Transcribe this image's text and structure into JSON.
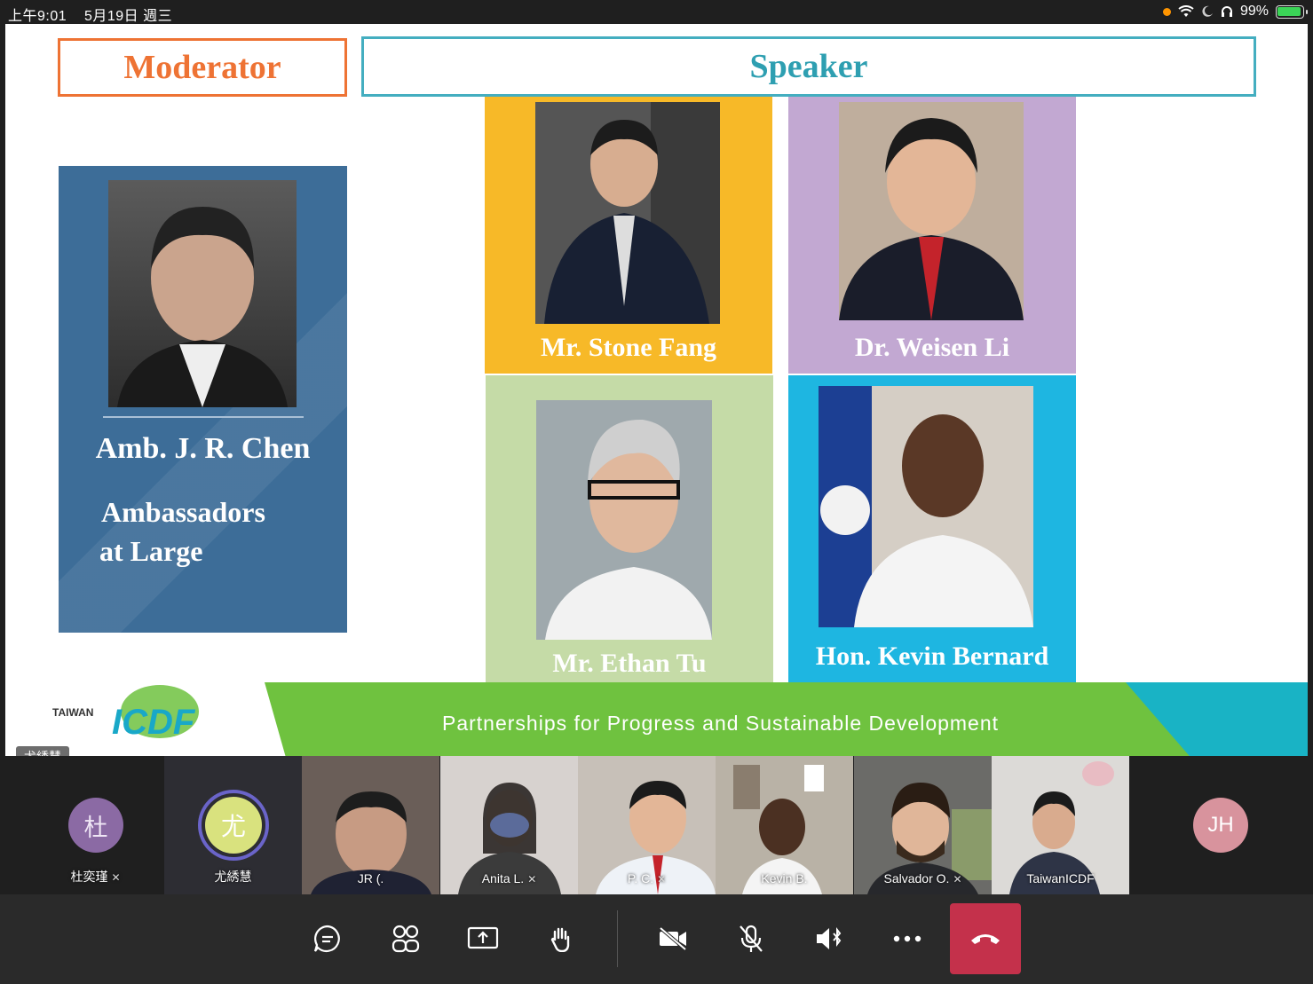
{
  "status_bar": {
    "time": "上午9:01",
    "date": "5月19日 週三",
    "battery": "99%"
  },
  "slide": {
    "moderator_header": "Moderator",
    "speaker_header": "Speaker",
    "moderator": {
      "name": "Amb. J. R. Chen",
      "title_line1": "Ambassadors",
      "title_line2": "at Large"
    },
    "speakers": [
      {
        "name": "Mr. Stone Fang"
      },
      {
        "name": "Dr. Weisen Li"
      },
      {
        "name": "Mr. Ethan Tu"
      },
      {
        "name": "Hon. Kevin Bernard"
      }
    ],
    "banner_text": "Partnerships for Progress and Sustainable Development",
    "logo_taiwan": "TAIWAN",
    "logo_icdf": "ICDF",
    "presenter_tag": "尤綉慧"
  },
  "participants": [
    {
      "name": "",
      "muted": true,
      "kind": "cut"
    },
    {
      "name": "杜奕瑾",
      "muted": true,
      "kind": "avatar",
      "initial": "杜",
      "color": "#8b6aa4"
    },
    {
      "name": "尤綉慧",
      "muted": false,
      "kind": "avatar",
      "initial": "尤",
      "color": "#d9e27e"
    },
    {
      "name": "JR (.",
      "muted": false,
      "kind": "video",
      "bg": "#6a5e58"
    },
    {
      "name": "Anita L.",
      "muted": true,
      "kind": "video",
      "bg": "#d7d2cf"
    },
    {
      "name": "P. C.",
      "muted": true,
      "kind": "video",
      "bg": "#c7c0b8"
    },
    {
      "name": "Kevin B.",
      "muted": false,
      "kind": "video",
      "bg": "#b9b2a6"
    },
    {
      "name": "Salvador O.",
      "muted": true,
      "kind": "video",
      "bg": "#6b6b68"
    },
    {
      "name": "TaiwanICDF",
      "muted": false,
      "kind": "video",
      "bg": "#dcdad7"
    },
    {
      "name": "",
      "muted": false,
      "kind": "avatar",
      "initial": "JH",
      "color": "#d8939d"
    }
  ],
  "controls": {
    "chat": "chat-icon",
    "people": "people-icon",
    "share": "share-screen-icon",
    "raise_hand": "raise-hand-icon",
    "camera": "camera-off-icon",
    "mic": "mic-off-icon",
    "speaker": "speaker-icon",
    "more": "more-icon",
    "leave": "hang-up-icon"
  },
  "colors": {
    "moderator_accent": "#ee7334",
    "speaker_accent": "#44aec0",
    "moderator_panel": "#3d6d98",
    "hangup": "#c4314b"
  }
}
